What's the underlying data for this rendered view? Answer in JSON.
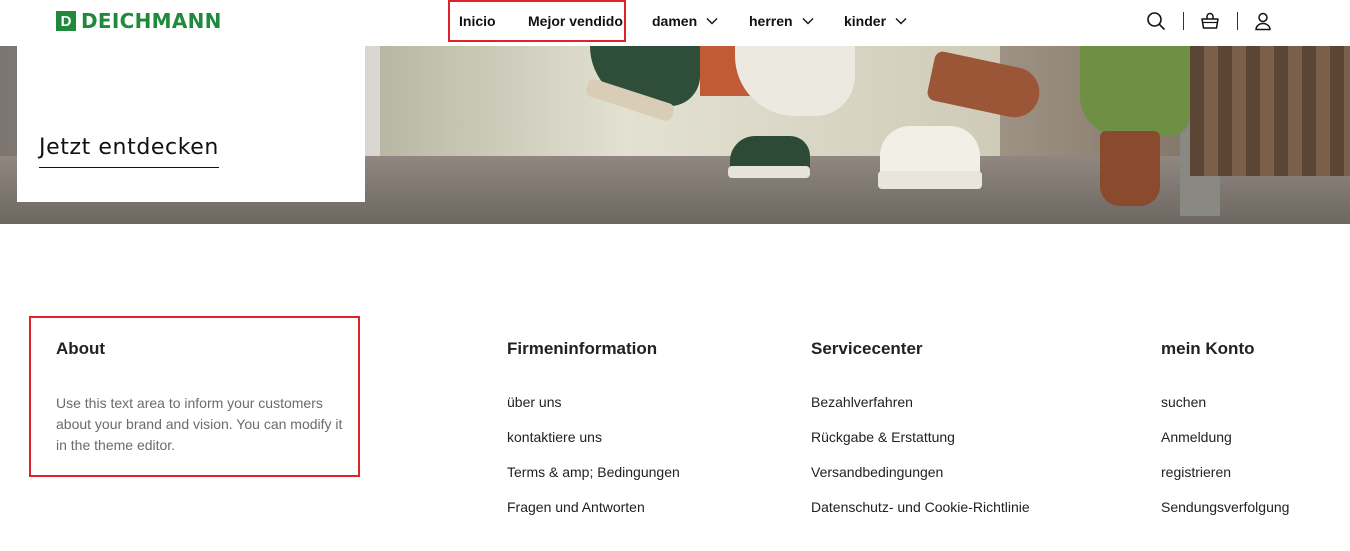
{
  "header": {
    "logo_mark": "D",
    "logo_text": "DEICHMANN",
    "nav": [
      {
        "label": "Inicio",
        "dropdown": false
      },
      {
        "label": "Mejor vendido",
        "dropdown": false
      },
      {
        "label": "damen",
        "dropdown": true
      },
      {
        "label": "herren",
        "dropdown": true
      },
      {
        "label": "kinder",
        "dropdown": true
      }
    ],
    "icons": [
      "search-icon",
      "cart-icon",
      "account-icon"
    ]
  },
  "hero": {
    "link_label": "Jetzt entdecken"
  },
  "footer": {
    "about": {
      "title": "About",
      "text": "Use this text area to inform your customers about your brand and vision. You can modify it in the theme editor."
    },
    "columns": [
      {
        "title": "Firmeninformation",
        "links": [
          "über uns",
          "kontaktiere uns",
          "Terms & amp; Bedingungen",
          "Fragen und Antworten"
        ]
      },
      {
        "title": "Servicecenter",
        "links": [
          "Bezahlverfahren",
          "Rückgabe & Erstattung",
          "Versandbedingungen",
          "Datenschutz- und Cookie-Richtlinie"
        ]
      },
      {
        "title": "mein Konto",
        "links": [
          "suchen",
          "Anmeldung",
          "registrieren",
          "Sendungsverfolgung"
        ]
      }
    ]
  },
  "colors": {
    "brand_green": "#1f8a3b",
    "highlight_red": "#e0232b"
  }
}
